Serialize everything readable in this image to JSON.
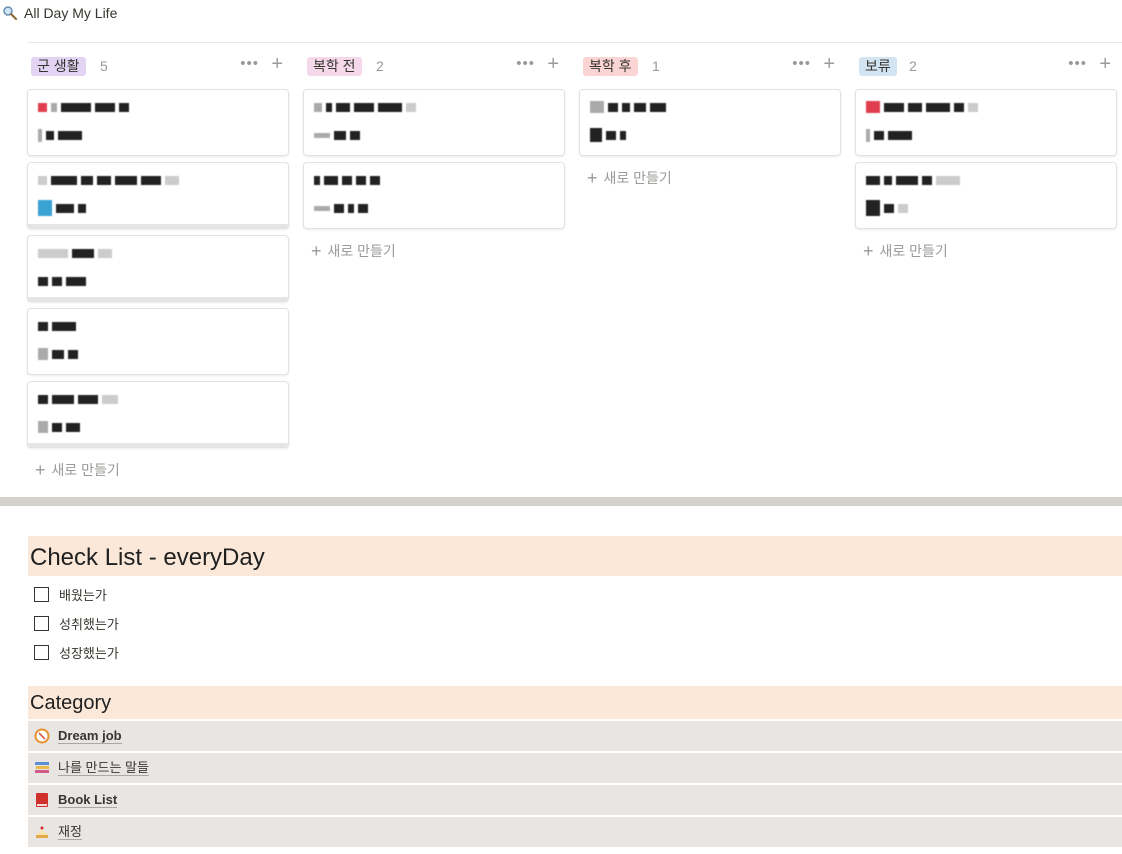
{
  "page": {
    "title": "All Day My Life"
  },
  "board": {
    "new_label": "새로 만들기",
    "more_icon": "more-horizontal-icon",
    "columns": [
      {
        "tag": "군 생활",
        "tag_color": "#e3d4f4",
        "count": "5"
      },
      {
        "tag": "복학 전",
        "tag_color": "#f5d9eb",
        "count": "2"
      },
      {
        "tag": "복학 후",
        "tag_color": "#fbd4d4",
        "count": "1"
      },
      {
        "tag": "보류",
        "tag_color": "#d3e5f3",
        "count": "2"
      }
    ]
  },
  "checklist": {
    "title": "Check List - everyDay",
    "items": [
      {
        "label": "배웠는가",
        "checked": false
      },
      {
        "label": "성취했는가",
        "checked": false
      },
      {
        "label": "성장했는가",
        "checked": false
      }
    ]
  },
  "category": {
    "title": "Category",
    "items": [
      {
        "label": "Dream job",
        "icon": "compass-icon"
      },
      {
        "label": "나를 만드는 말들",
        "icon": "books-icon"
      },
      {
        "label": "Book List",
        "icon": "red-book-icon"
      },
      {
        "label": "재정",
        "icon": "cake-icon"
      }
    ]
  }
}
